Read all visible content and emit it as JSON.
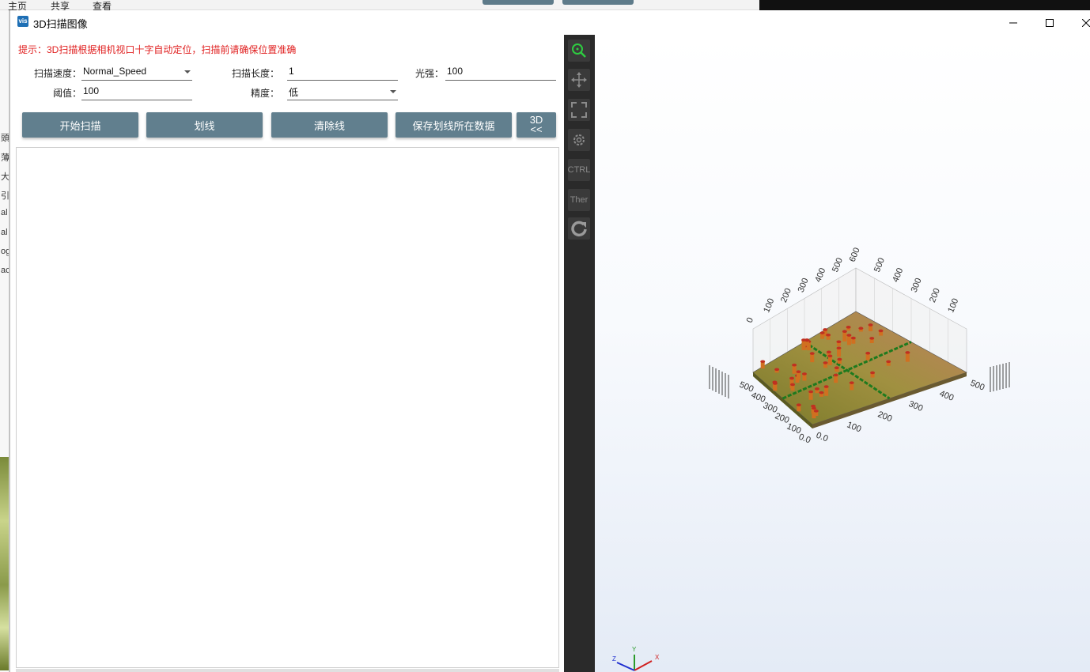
{
  "background_app": {
    "menu": [
      "主页",
      "共享",
      "查看"
    ],
    "side_chars": [
      "頭",
      "薄",
      "大",
      "引",
      "al",
      "al",
      "og",
      "ac"
    ]
  },
  "window": {
    "icon_text": "vis",
    "title": "3D扫描图像",
    "controls": {
      "minimize": "minimize-icon",
      "maximize": "maximize-icon",
      "close": "close-icon"
    }
  },
  "hint": "提示：3D扫描根据相机视口十字自动定位，扫描前请确保位置准确",
  "settings": {
    "speed_label": "扫描速度：",
    "speed_value": "Normal_Speed",
    "length_label": "扫描长度：",
    "length_value": "1",
    "light_label": "光强：",
    "light_value": "100",
    "threshold_label": "阈值：",
    "threshold_value": "100",
    "precision_label": "精度：",
    "precision_value": "低"
  },
  "buttons": {
    "start_scan": "开始扫描",
    "draw_line": "划线",
    "clear_line": "清除线",
    "save_line_data": "保存划线所在数据",
    "toggle_3d_top": "3D",
    "toggle_3d_bottom": "<<"
  },
  "toolbar": {
    "tools": [
      {
        "name": "zoom-icon",
        "label": ""
      },
      {
        "name": "move-icon",
        "label": ""
      },
      {
        "name": "fit-icon",
        "label": ""
      },
      {
        "name": "settings-icon",
        "label": ""
      },
      {
        "name": "ctrl-toggle",
        "label": "CTRL"
      },
      {
        "name": "theme-toggle",
        "label": "Ther"
      },
      {
        "name": "reset-icon",
        "label": ""
      }
    ]
  },
  "viewer": {
    "axis_ticks_left": [
      "0",
      "100",
      "200",
      "300",
      "400",
      "500",
      "600"
    ],
    "axis_ticks_right": [
      "500",
      "400",
      "300",
      "200",
      "100"
    ],
    "front_left_ticks": [
      "500",
      "400",
      "300",
      "200",
      "100",
      "0.0"
    ],
    "front_right_ticks": [
      "500",
      "400",
      "300",
      "200",
      "100",
      "0.0"
    ],
    "triad": {
      "x": "X",
      "y": "Y",
      "z": "Z"
    },
    "colors": {
      "surface": "#8a8a3a",
      "peak": "#c03020",
      "line": "#1e7a1e"
    }
  }
}
